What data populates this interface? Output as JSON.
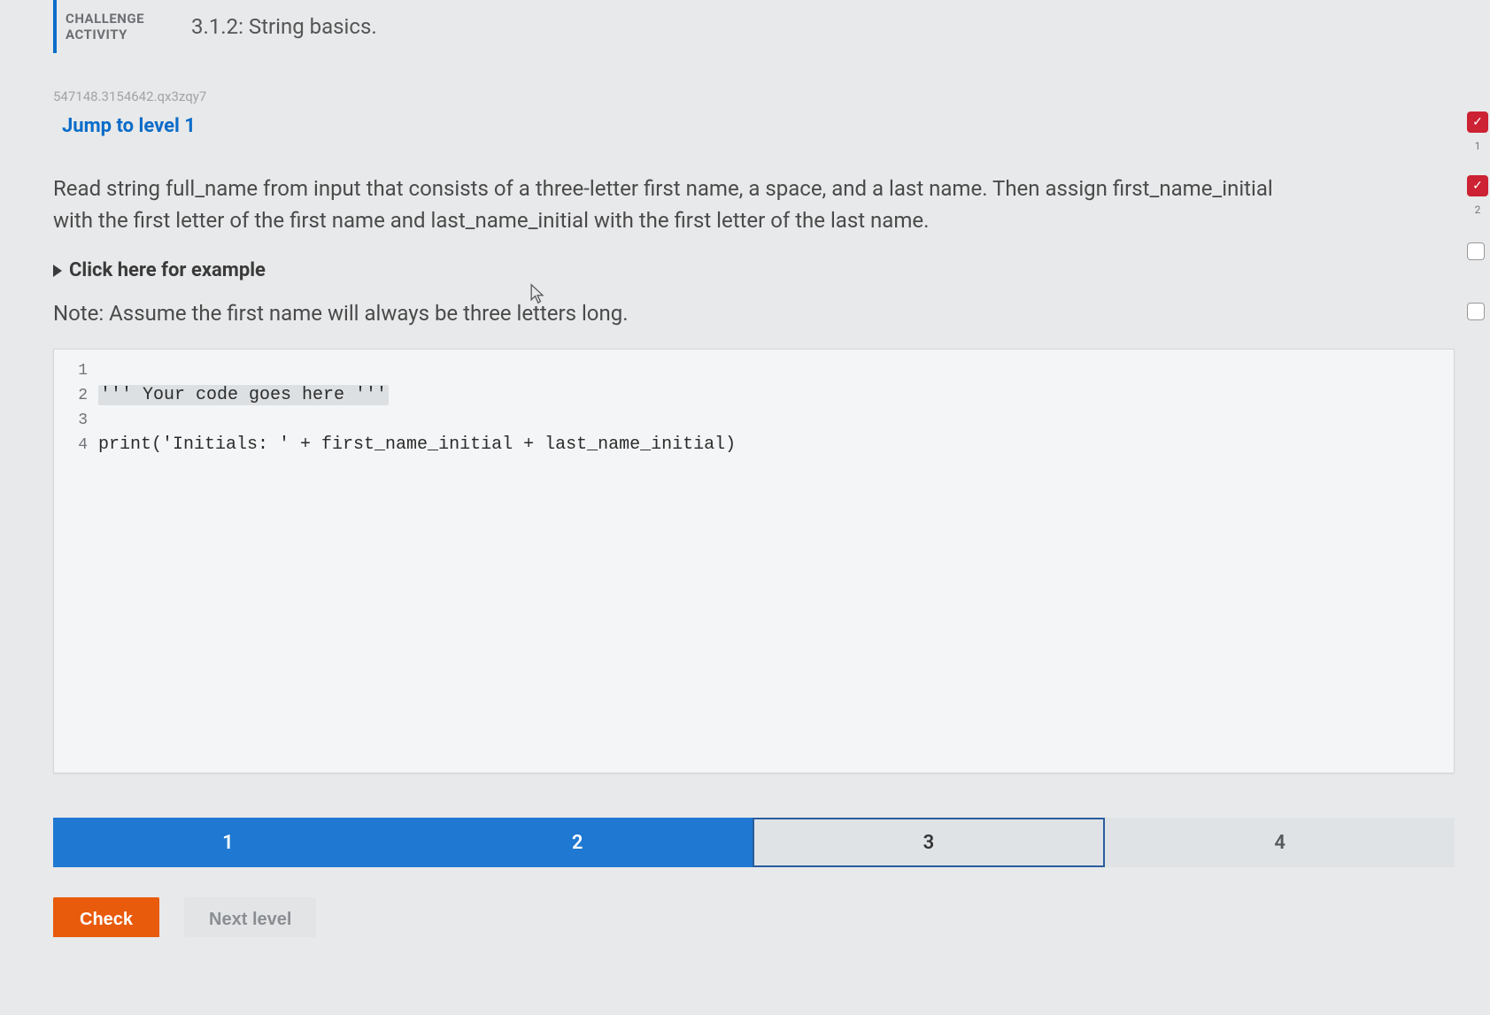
{
  "header": {
    "badge_line1": "CHALLENGE",
    "badge_line2": "ACTIVITY",
    "title": "3.1.2: String basics."
  },
  "activity_id": "547148.3154642.qx3zqy7",
  "jump_link": "Jump to level 1",
  "prompt": "Read string full_name from input that consists of a three-letter first name, a space, and a last name. Then assign first_name_initial with the first letter of the first name and last_name_initial with the first letter of the last name.",
  "example_toggle": "Click here for example",
  "note": "Note: Assume the first name will always be three letters long.",
  "code": {
    "lines": [
      {
        "n": "1",
        "text": ""
      },
      {
        "n": "2",
        "text": "''' Your code goes here '''",
        "highlight": true
      },
      {
        "n": "3",
        "text": ""
      },
      {
        "n": "4",
        "text": "print('Initials: ' + first_name_initial + last_name_initial)"
      }
    ]
  },
  "progress": {
    "steps": [
      {
        "label": "1",
        "state": "active"
      },
      {
        "label": "2",
        "state": "active"
      },
      {
        "label": "3",
        "state": "current"
      },
      {
        "label": "4",
        "state": "pending"
      }
    ]
  },
  "actions": {
    "check": "Check",
    "next": "Next level"
  },
  "rail": {
    "n1": "1",
    "n2": "2"
  }
}
